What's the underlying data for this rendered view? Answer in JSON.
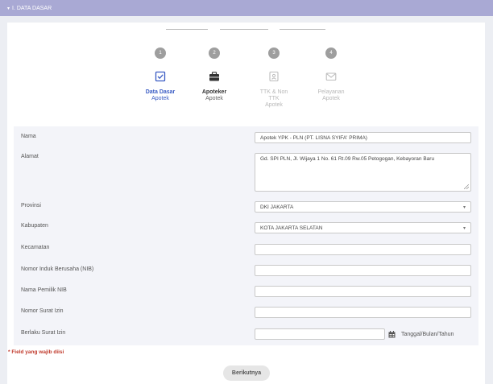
{
  "section": {
    "title": "I. DATA DASAR"
  },
  "wizard": {
    "steps": [
      {
        "number": "1",
        "label": "Data Dasar",
        "sub": "Apotek",
        "icon": "checkbox-icon",
        "state": "active"
      },
      {
        "number": "2",
        "label": "Apoteker",
        "sub": "Apotek",
        "icon": "briefcase-icon",
        "state": "done"
      },
      {
        "number": "3",
        "label": "TTK & Non TTK",
        "sub": "Apotek",
        "icon": "id-card-icon",
        "state": "disabled"
      },
      {
        "number": "4",
        "label": "Pelayanan",
        "sub": "Apotek",
        "icon": "envelope-icon",
        "state": "disabled"
      }
    ],
    "step3_label_line1": "TTK & Non",
    "step3_label_line2": "TTK"
  },
  "form": {
    "nama": {
      "label": "Nama",
      "value": "Apotek YPK - PLN (PT. LISNA SYIFA' PRIMA)"
    },
    "alamat": {
      "label": "Alamat",
      "value": "Gd. SPI PLN, Jl. Wijaya 1 No. 61 Rt.09 Rw.05 Petogogan, Kebayoran Baru"
    },
    "provinsi": {
      "label": "Provinsi",
      "value": "DKI JAKARTA"
    },
    "kabupaten": {
      "label": "Kabupaten",
      "value": "KOTA JAKARTA SELATAN"
    },
    "kecamatan": {
      "label": "Kecamatan",
      "value": ""
    },
    "nib": {
      "label": "Nomor Induk Berusaha (NIB)",
      "value": ""
    },
    "pemilik_nib": {
      "label": "Nama Pemilik NIB",
      "value": ""
    },
    "surat_izin": {
      "label": "Nomor Surat Izin",
      "value": ""
    },
    "berlaku": {
      "label": "Berlaku Surat Izin",
      "value": "",
      "hint": "Tanggal/Bulan/Tahun"
    }
  },
  "required_note": "* Field yang wajib diisi",
  "next_button": "Berikutnya",
  "colors": {
    "header": "#a9a9d4",
    "active": "#3a5cc4",
    "required": "#c0392b"
  }
}
